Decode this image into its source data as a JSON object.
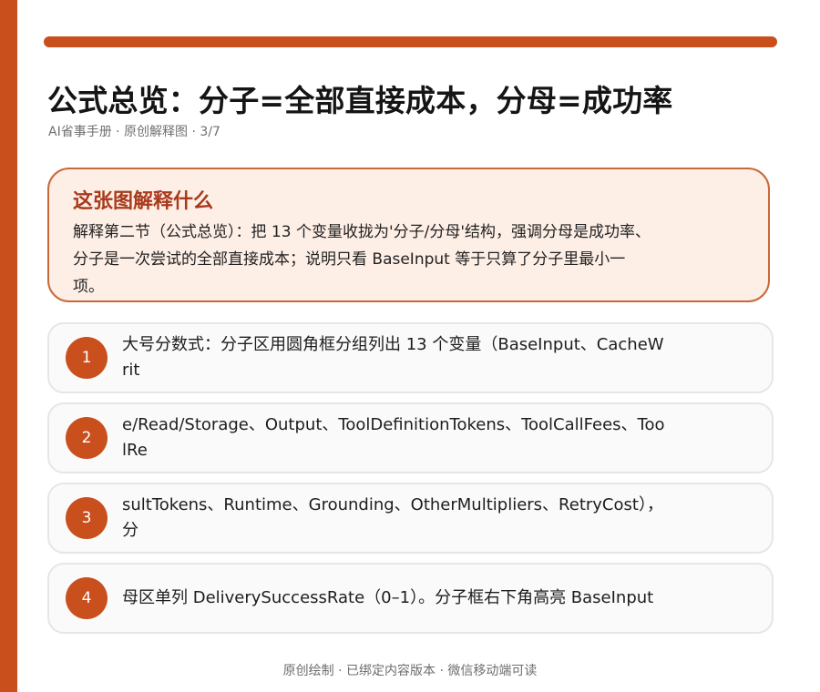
{
  "header": {
    "title": "公式总览：分子=全部直接成本，分母=成功率",
    "subtitle": "AI省事手册 · 原创解释图 · 3/7"
  },
  "explanation": {
    "heading": "这张图解释什么",
    "body": "解释第二节（公式总览）：把 13 个变量收拢为'分子/分母'结构，强调分母是成功率、分子是一次尝试的全部直接成本；说明只看 BaseInput 等于只算了分子里最小一项。"
  },
  "steps": [
    {
      "number": "1",
      "text": "大号分数式：分子区用圆角框分组列出 13 个变量（BaseInput、CacheWrit"
    },
    {
      "number": "2",
      "text": "e/Read/Storage、Output、ToolDefinitionTokens、ToolCallFees、ToolRe"
    },
    {
      "number": "3",
      "text": "sultTokens、Runtime、Grounding、OtherMultipliers、RetryCost），分"
    },
    {
      "number": "4",
      "text": "母区单列 DeliverySuccessRate（0–1）。分子框右下角高亮 BaseInput"
    }
  ],
  "footer": {
    "text": "原创绘制 · 已绑定内容版本 · 微信移动端可读"
  },
  "colors": {
    "accent": "#c94f1d",
    "explain_background": "#fdeee6",
    "explain_heading": "#a83a1c"
  }
}
